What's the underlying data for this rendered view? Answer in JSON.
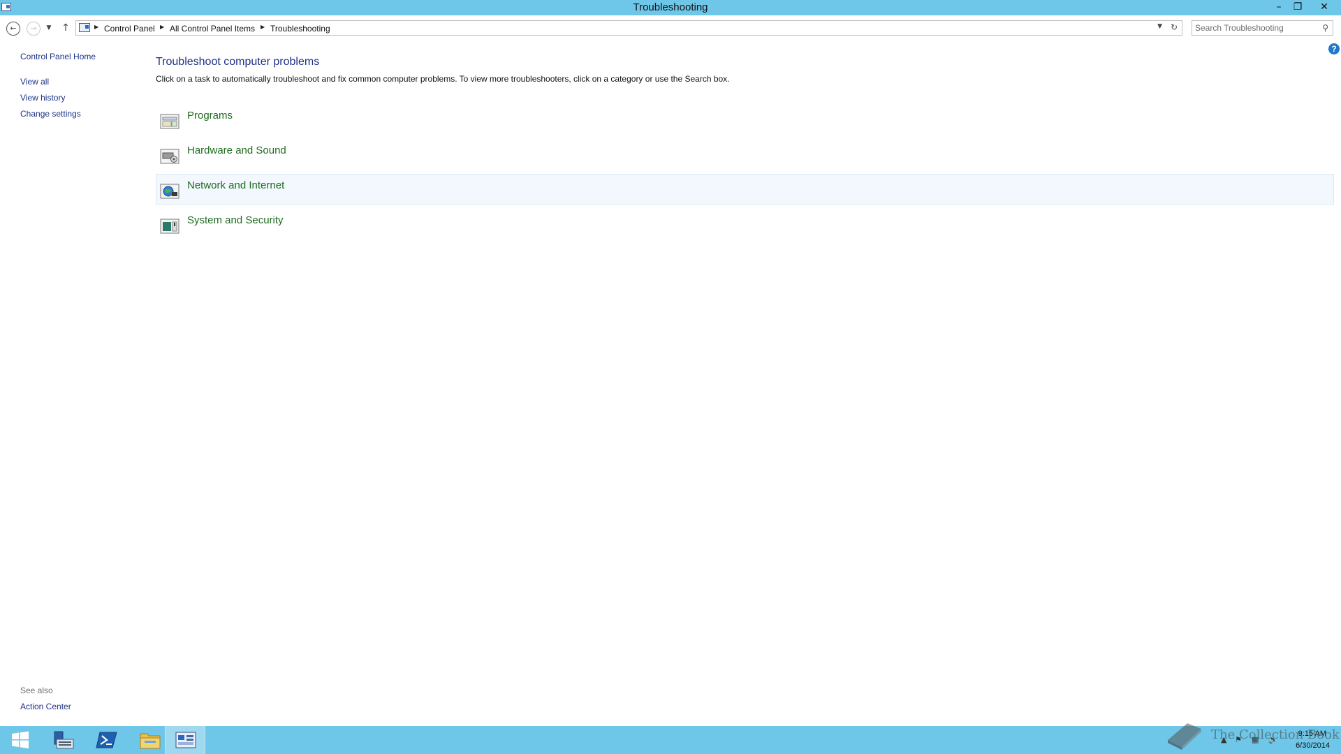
{
  "window": {
    "title": "Troubleshooting",
    "buttons": {
      "minimize": "–",
      "maximize": "❐",
      "close": "✕"
    }
  },
  "address_bar": {
    "breadcrumb": [
      "Control Panel",
      "All Control Panel Items",
      "Troubleshooting"
    ],
    "search_placeholder": "Search Troubleshooting"
  },
  "sidebar": {
    "home": "Control Panel Home",
    "links": [
      "View all",
      "View history",
      "Change settings"
    ],
    "see_also_heading": "See also",
    "see_also_links": [
      "Action Center"
    ]
  },
  "main": {
    "title": "Troubleshoot computer problems",
    "description": "Click on a task to automatically troubleshoot and fix common computer problems. To view more troubleshooters, click on a category or use the Search box.",
    "categories": [
      {
        "label": "Programs",
        "icon": "programs-icon"
      },
      {
        "label": "Hardware and Sound",
        "icon": "hardware-sound-icon"
      },
      {
        "label": "Network and Internet",
        "icon": "network-internet-icon",
        "hovered": true
      },
      {
        "label": "System and Security",
        "icon": "system-security-icon"
      }
    ]
  },
  "taskbar": {
    "pinned": [
      "start-icon",
      "server-manager-icon",
      "powershell-icon",
      "file-explorer-icon",
      "control-panel-icon"
    ],
    "active": "control-panel-icon",
    "clock": {
      "time": "9:15 AM",
      "date": "6/30/2014"
    }
  },
  "watermark": "The Collection Book",
  "colors": {
    "titlebar": "#6ec6e8",
    "link": "#1e3287",
    "category_link": "#1f6b1f",
    "hover_row": "#f2f8fd"
  }
}
